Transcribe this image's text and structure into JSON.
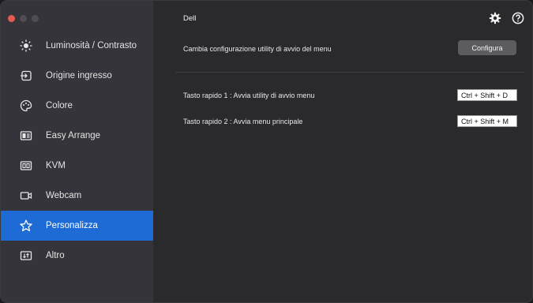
{
  "sidebar": {
    "items": [
      {
        "label": "Luminosità / Contrasto",
        "icon": "brightness-icon"
      },
      {
        "label": "Origine ingresso",
        "icon": "input-source-icon"
      },
      {
        "label": "Colore",
        "icon": "color-palette-icon"
      },
      {
        "label": "Easy Arrange",
        "icon": "easy-arrange-icon"
      },
      {
        "label": "KVM",
        "icon": "kvm-icon"
      },
      {
        "label": "Webcam",
        "icon": "webcam-icon"
      },
      {
        "label": "Personalizza",
        "icon": "star-icon",
        "active": true
      },
      {
        "label": "Altro",
        "icon": "others-icon"
      }
    ]
  },
  "main": {
    "title": "Dell",
    "config_label": "Cambia configurazione utility di avvio del menu",
    "config_button": "Configura",
    "hotkey1_label": "Tasto rapido 1 : Avvia utility di avvio menu",
    "hotkey1_value": "Ctrl + Shift + D",
    "hotkey2_label": "Tasto rapido 2 : Avvia menu principale",
    "hotkey2_value": "Ctrl + Shift + M"
  },
  "colors": {
    "accent": "#1e6bd6",
    "sidebar_bg": "#34343a",
    "main_bg": "#2a2a2d"
  }
}
